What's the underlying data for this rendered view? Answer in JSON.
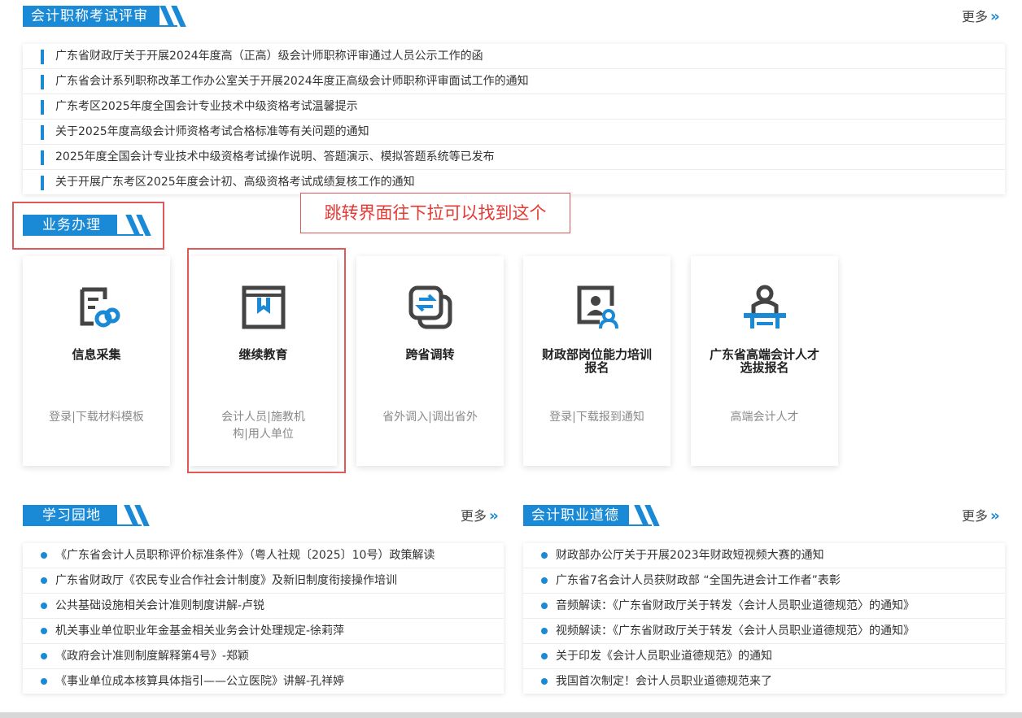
{
  "sections": {
    "exam": {
      "title": "会计职称考试评审",
      "more": "更多"
    },
    "business": {
      "title": "业务办理"
    },
    "study": {
      "title": "学习园地",
      "more": "更多"
    },
    "ethics": {
      "title": "会计职业道德",
      "more": "更多"
    }
  },
  "exam_news": [
    "广东省财政厅关于开展2024年度高（正高）级会计师职称评审通过人员公示工作的函",
    "广东省会计系列职称改革工作办公室关于开展2024年度正高级会计师职称评审面试工作的通知",
    "广东考区2025年度全国会计专业技术中级资格考试温馨提示",
    "关于2025年度高级会计师资格考试合格标准等有关问题的通知",
    "2025年度全国会计专业技术中级资格考试操作说明、答题演示、模拟答题系统等已发布",
    "关于开展广东考区2025年度会计初、高级资格考试成绩复核工作的通知"
  ],
  "annotation": "跳转界面往下拉可以找到这个",
  "cards": [
    {
      "title": "信息采集",
      "sub": "登录|下载材料模板",
      "icon": "info-collect-icon"
    },
    {
      "title": "继续教育",
      "sub": "会计人员|施教机构|用人单位",
      "icon": "continuing-education-icon"
    },
    {
      "title": "跨省调转",
      "sub": "省外调入|调出省外",
      "icon": "transfer-icon"
    },
    {
      "title": "财政部岗位能力培训报名",
      "sub": "登录|下载报到通知",
      "icon": "training-signup-icon"
    },
    {
      "title": "广东省高端会计人才选拔报名",
      "sub": "高端会计人才",
      "icon": "talent-selection-icon"
    }
  ],
  "study_items": [
    "《广东省会计人员职称评价标准条件》（粤人社规〔2025〕10号）政策解读",
    "广东省财政厅《农民专业合作社会计制度》及新旧制度衔接操作培训",
    "公共基础设施相关会计准则制度讲解-卢锐",
    "机关事业单位职业年金基金相关业务会计处理规定-徐莉萍",
    "《政府会计准则制度解释第4号》-郑颖",
    "《事业单位成本核算具体指引——公立医院》讲解-孔祥婷"
  ],
  "ethics_items": [
    "财政部办公厅关于开展2023年财政短视频大赛的通知",
    "广东省7名会计人员获财政部 “全国先进会计工作者”表彰",
    "音频解读：《广东省财政厅关于转发〈会计人员职业道德规范〉的通知》",
    "视频解读：《广东省财政厅关于转发〈会计人员职业道德规范〉的通知》",
    "关于印发《会计人员职业道德规范》的通知",
    "我国首次制定！会计人员职业道德规范来了"
  ],
  "colors": {
    "accent": "#1a8ad6",
    "highlight": "#e0585a",
    "annotation_text": "#e53935"
  }
}
